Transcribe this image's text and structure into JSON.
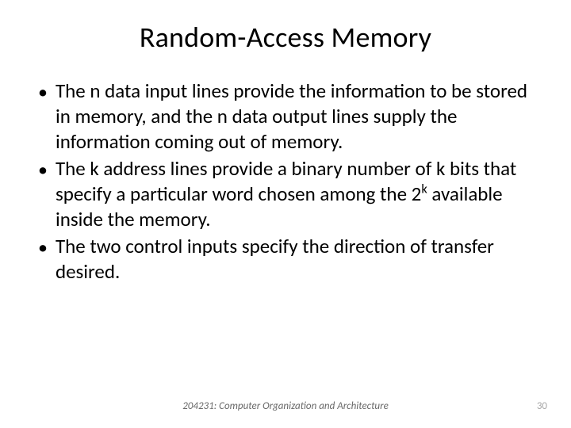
{
  "title": "Random-Access Memory",
  "bullets": [
    {
      "pre": "The n data input lines provide the information to be stored in memory, and the n data output lines supply the information coming out of memory."
    },
    {
      "pre": "The k address lines provide a binary number of k bits that specify a particular word chosen among the 2",
      "sup": "k",
      "post": " available inside the memory."
    },
    {
      "pre": "The two control inputs specify the direction of transfer desired."
    }
  ],
  "footer": "204231: Computer Organization and Architecture",
  "page_number": "30",
  "bullet_char": "•"
}
